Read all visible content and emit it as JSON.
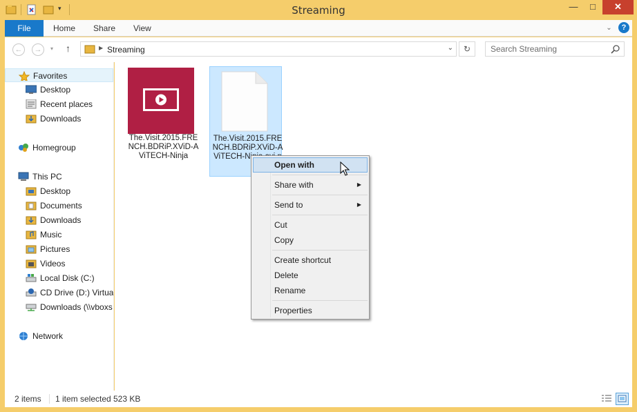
{
  "window": {
    "title": "Streaming"
  },
  "ribbon": {
    "tabs": [
      "File",
      "Home",
      "Share",
      "View"
    ]
  },
  "address": {
    "path": "Streaming",
    "search_placeholder": "Search Streaming"
  },
  "nav": {
    "favorites": "Favorites",
    "fav_items": [
      "Desktop",
      "Recent places",
      "Downloads"
    ],
    "homegroup": "Homegroup",
    "thispc": "This PC",
    "pc_items": [
      "Desktop",
      "Documents",
      "Downloads",
      "Music",
      "Pictures",
      "Videos",
      "Local Disk (C:)",
      "CD Drive (D:) Virtual",
      "Downloads (\\\\vboxs"
    ],
    "network": "Network"
  },
  "files": [
    {
      "name": "The.Visit.2015.FRENCH.BDRiP.XViD-AViTECH-Ninja",
      "type": "video-folder"
    },
    {
      "name": "The.Visit.2015.FRENCH.BDRiP.XViD-AViTECH-Ninja.avi.p",
      "type": "file",
      "selected": true
    }
  ],
  "status": {
    "count": "2 items",
    "selected": "1 item selected",
    "size": "523 KB"
  },
  "context_menu": {
    "items": [
      "Open with",
      "Share with",
      "Send to",
      "Cut",
      "Copy",
      "Create shortcut",
      "Delete",
      "Rename",
      "Properties"
    ],
    "highlighted": "Open with"
  },
  "colors": {
    "accent": "#1979ca",
    "titlebar": "#f5cd6b",
    "video_tile": "#b01f44",
    "selection": "#cce8ff"
  }
}
